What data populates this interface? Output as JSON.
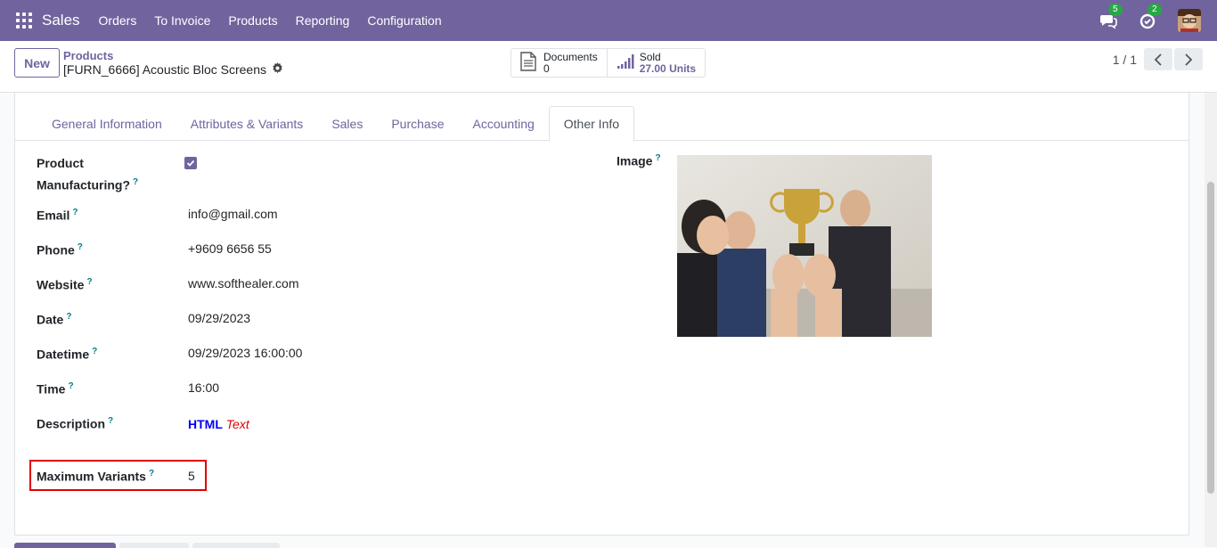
{
  "app": {
    "name": "Sales"
  },
  "menu": [
    "Orders",
    "To Invoice",
    "Products",
    "Reporting",
    "Configuration"
  ],
  "systray": {
    "messages_count": "5",
    "activities_count": "2"
  },
  "control": {
    "new_label": "New",
    "breadcrumb_parent": "Products",
    "breadcrumb_current": "[FURN_6666] Acoustic Bloc Screens",
    "pager": "1 / 1"
  },
  "stats": {
    "documents_label": "Documents",
    "documents_value": "0",
    "sold_label": "Sold",
    "sold_value": "27.00 Units"
  },
  "tabs": [
    "General Information",
    "Attributes & Variants",
    "Sales",
    "Purchase",
    "Accounting",
    "Other Info"
  ],
  "active_tab": "Other Info",
  "fields": {
    "manufacturing_label_1": "Product",
    "manufacturing_label_2": "Manufacturing?",
    "manufacturing_checked": true,
    "email_label": "Email",
    "email_value": "info@gmail.com",
    "phone_label": "Phone",
    "phone_value": "+9609 6656 55",
    "website_label": "Website",
    "website_value": "www.softhealer.com",
    "date_label": "Date",
    "date_value": "09/29/2023",
    "datetime_label": "Datetime",
    "datetime_value": "09/29/2023 16:00:00",
    "time_label": "Time",
    "time_value": "16:00",
    "description_label": "Description",
    "description_html": "HTML",
    "description_text": "Text",
    "max_variants_label": "Maximum Variants",
    "max_variants_value": "5",
    "image_label": "Image",
    "help_mark": "?"
  },
  "colors": {
    "primary": "#71639e",
    "highlight": "#e00000"
  }
}
